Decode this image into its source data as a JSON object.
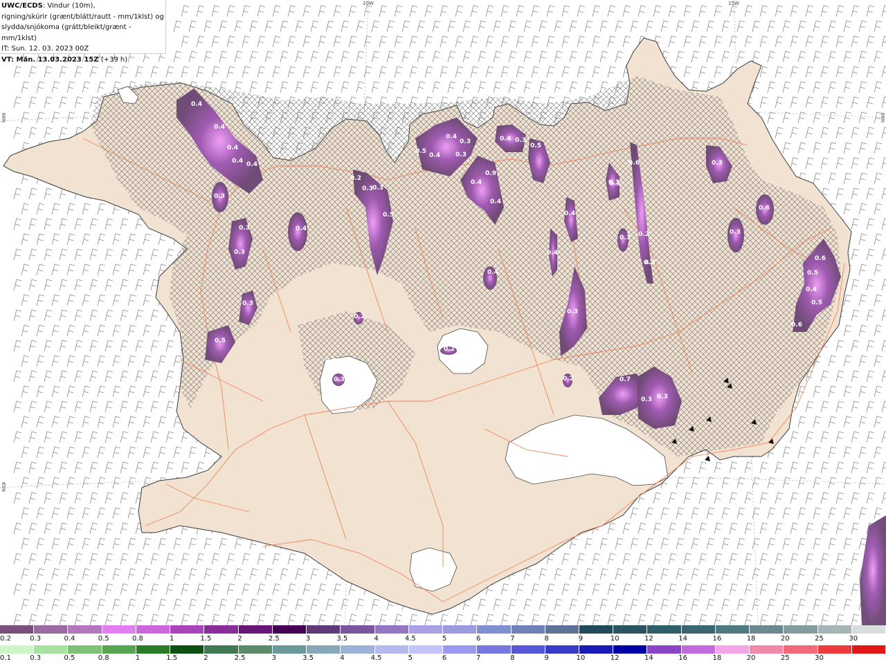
{
  "header": {
    "line1_bold": "UWC/ECDS",
    "line1_rest": ": Vindur (10m),",
    "line2": "rigning/skúrir (grænt/blátt/rautt - mm/1klst) og",
    "line3": "slydda/snjókoma (grátt/bleikt/grænt - mm/1klst)",
    "line4": "IT: Sun. 12. 03. 2023 00Z",
    "line5_bold": "VT: Mán. 13.03.2023 15Z",
    "line5_rest": " (+39 h)"
  },
  "graticule": {
    "lon_labels": [
      "20W",
      "15W"
    ],
    "lat_labels": [
      "66N",
      "66N",
      "65N"
    ]
  },
  "blob_labels": [
    "0.4",
    "0.4",
    "0.4",
    "0.4",
    "0.4",
    "0.3",
    "0.3",
    "0.3",
    "0.3",
    "0.5",
    "0.4",
    "0.2",
    "0.3",
    "0.3",
    "0.5",
    "0.5",
    "0.4",
    "0.4",
    "0.3",
    "0.3",
    "0.4",
    "0.3",
    "0.4",
    "0.9",
    "0.4",
    "0.5",
    "0.4",
    "0.6",
    "0.3",
    "0.3",
    "0.4",
    "0.3",
    "0.2",
    "0.3",
    "0.3",
    "0.4",
    "0.2",
    "0.2",
    "0.2",
    "0.3",
    "0.3",
    "0.7",
    "0.3",
    "0.3",
    "0.6",
    "0.3",
    "0.5",
    "0.6",
    "0.4",
    "0.5",
    "0.6",
    "0.3",
    "0.2"
  ],
  "legend_snow": {
    "labels": [
      "0.2",
      "0.3",
      "0.4",
      "0.5",
      "0.8",
      "1",
      "1.5",
      "2",
      "2.5",
      "3",
      "3.5",
      "4",
      "4.5",
      "5",
      "6",
      "7",
      "8",
      "9",
      "10",
      "12",
      "14",
      "16",
      "18",
      "20",
      "25",
      "30"
    ],
    "colors": [
      "#7a4f7e",
      "#9a6aa0",
      "#b476bd",
      "#e27ff0",
      "#cc66dd",
      "#aa44bb",
      "#882d99",
      "#661677",
      "#450055",
      "#5e3a7a",
      "#7a55a0",
      "#9377c5",
      "#aaa0e6",
      "#9b9be0",
      "#7f8fcf",
      "#6f82b8",
      "#5f7399",
      "#1f4a5a",
      "#2a5560",
      "#2e5e68",
      "#3b6670",
      "#4f7a80",
      "#6a8a90",
      "#849ca0",
      "#a8b5b8",
      "#d7dcdc"
    ]
  },
  "legend_rain": {
    "labels": [
      "0.1",
      "0.3",
      "0.5",
      "0.8",
      "1",
      "1.5",
      "2",
      "2.5",
      "3",
      "3.5",
      "4",
      "4.5",
      "5",
      "6",
      "7",
      "8",
      "9",
      "10",
      "12",
      "14",
      "16",
      "18",
      "20",
      "25",
      "30"
    ],
    "colors": [
      "#cdf5c8",
      "#a8e2a0",
      "#7fc277",
      "#56a44f",
      "#2a7d27",
      "#0f4f12",
      "#3f7a52",
      "#5a8a6a",
      "#6b9898",
      "#86a8b8",
      "#9eb2d8",
      "#b4b9ee",
      "#c4c4f8",
      "#9a9af0",
      "#7777e4",
      "#5656d8",
      "#3a3ac8",
      "#1a1ab8",
      "#0000a8",
      "#8a44c8",
      "#c26ae0",
      "#f2a6e6",
      "#f08aa8",
      "#f06a7a",
      "#ee3a3a",
      "#e21616"
    ]
  },
  "colors": {
    "land": "#f2e2d2",
    "roads": "#f0855a",
    "coast": "#3a3a3a",
    "wind_barb": "#8a8a8a",
    "snow_light": "#6a4572",
    "snow_mid": "#8f4ea3",
    "snow_high": "#e27ff0"
  }
}
